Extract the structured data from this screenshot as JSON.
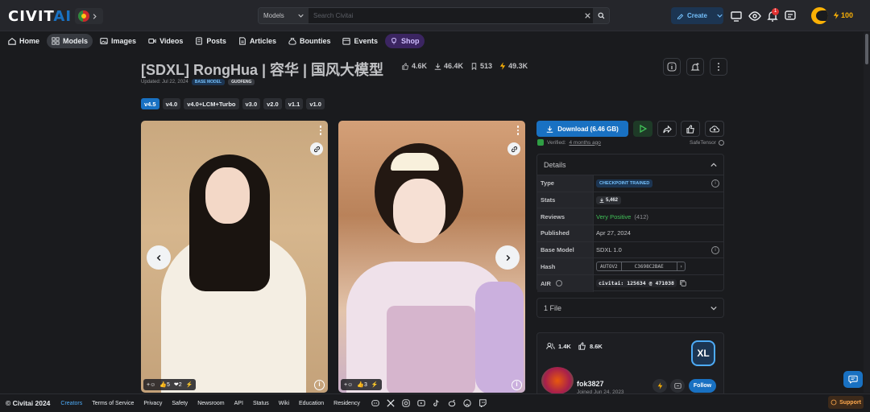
{
  "header": {
    "logo_main": "CIVIT",
    "logo_ai": "AI",
    "search": {
      "filter": "Models",
      "placeholder": "Search Civitai"
    },
    "create_label": "Create",
    "notification_count": "1",
    "buzz_amount": "100"
  },
  "nav": {
    "items": [
      {
        "label": "Home"
      },
      {
        "label": "Models"
      },
      {
        "label": "Images"
      },
      {
        "label": "Videos"
      },
      {
        "label": "Posts"
      },
      {
        "label": "Articles"
      },
      {
        "label": "Bounties"
      },
      {
        "label": "Events"
      },
      {
        "label": "Shop"
      }
    ]
  },
  "model": {
    "title": "[SDXL] RongHua | 容华 | 国风大模型",
    "stats": {
      "likes": "4.6K",
      "downloads": "46.4K",
      "bookmarks": "513",
      "buzz": "49.3K"
    },
    "updated": "Updated: Jul 22, 2024",
    "tags": [
      "BASE MODEL",
      "GUOFENG"
    ],
    "versions": [
      "v4.5",
      "v4.0",
      "v4.0+LCM+Turbo",
      "v3.0",
      "v2.0",
      "v1.1",
      "v1.0"
    ]
  },
  "gallery": {
    "image1": {
      "reactions": {
        "likes": "5",
        "hearts": "2"
      }
    },
    "image2": {
      "reactions": {
        "likes": "3"
      }
    }
  },
  "download": {
    "label": "Download (6.46 GB)",
    "verified_prefix": "Verified:",
    "verified_when": "4 months ago",
    "safetensor": "SafeTensor"
  },
  "details": {
    "heading": "Details",
    "rows": {
      "type": {
        "label": "Type",
        "value": "CHECKPOINT TRAINED"
      },
      "stats": {
        "label": "Stats",
        "value": "5,462"
      },
      "reviews": {
        "label": "Reviews",
        "value": "Very Positive",
        "count": "(412)"
      },
      "published": {
        "label": "Published",
        "value": "Apr 27, 2024"
      },
      "base_model": {
        "label": "Base Model",
        "value": "SDXL 1.0"
      },
      "hash": {
        "label": "Hash",
        "algo": "AUTOV2",
        "value": "C3698C2BAE"
      },
      "air": {
        "label": "AIR",
        "value": "civitai: 125634 @ 471038"
      }
    }
  },
  "files": {
    "label": "1 File"
  },
  "creator": {
    "followers": "1.4K",
    "likes": "8.6K",
    "name": "fok3827",
    "joined": "Joined Jun 24, 2023",
    "follow_label": "Follow",
    "badge": "XL"
  },
  "footer": {
    "copyright": "© Civitai 2024",
    "links": [
      "Creators",
      "Terms of Service",
      "Privacy",
      "Safety",
      "Newsroom",
      "API",
      "Status",
      "Wiki",
      "Education",
      "Residency"
    ],
    "support": "Support"
  },
  "colors": {
    "accent": "#1971c2",
    "background": "#1a1b1e",
    "shop": "#3b2561",
    "buzz": "#fab005"
  }
}
